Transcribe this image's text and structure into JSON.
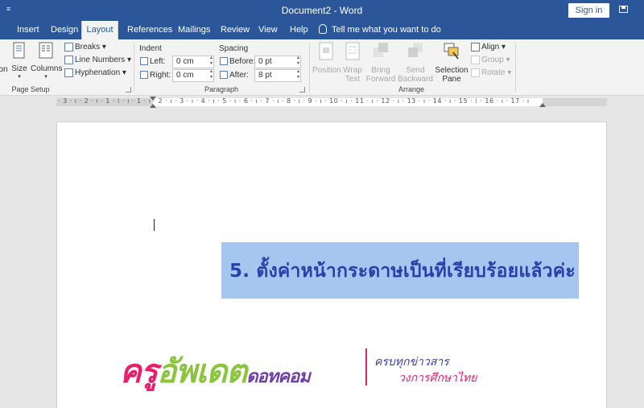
{
  "titlebar": {
    "quick_access": "≡",
    "title": "Document2 - Word",
    "signin": "Sign in"
  },
  "tabs": [
    {
      "label": "Insert"
    },
    {
      "label": "Design"
    },
    {
      "label": "Layout"
    },
    {
      "label": "References"
    },
    {
      "label": "Mailings"
    },
    {
      "label": "Review"
    },
    {
      "label": "View"
    },
    {
      "label": "Help"
    }
  ],
  "active_tab": "Layout",
  "tell_me": "Tell me what you want to do",
  "ribbon": {
    "page_setup": {
      "orientation_partial": "on",
      "size": "Size",
      "columns": "Columns",
      "breaks": "Breaks ▾",
      "line_numbers": "Line Numbers ▾",
      "hyphenation": "Hyphenation ▾",
      "label": "Page Setup"
    },
    "paragraph": {
      "indent_heading": "Indent",
      "spacing_heading": "Spacing",
      "left_label": "Left:",
      "left_value": "0 cm",
      "right_label": "Right:",
      "right_value": "0 cm",
      "before_label": "Before:",
      "before_value": "0 pt",
      "after_label": "After:",
      "after_value": "8 pt",
      "label": "Paragraph"
    },
    "arrange": {
      "position": "Position",
      "wrap_text": "Wrap Text",
      "bring_forward": "Bring Forward",
      "send_backward": "Send Backward",
      "selection_pane": "Selection Pane",
      "align": "Align ▾",
      "group": "Group ▾",
      "rotate": "Rotate ▾",
      "label": "Arrange",
      "wrap_l1": "Wrap",
      "wrap_l2": "Text",
      "bring_l1": "Bring",
      "bring_l2": "Forward",
      "send_l1": "Send",
      "send_l2": "Backward",
      "sel_l1": "Selection",
      "sel_l2": "Pane"
    }
  },
  "ruler": {
    "numbers": "· 3 · ı · 2 · ı · 1 · ⁞ · ı · 1 · ı · 2 · ı · 3 · ı · 4 · ı · 5 · ı · 6 · ı · 7 · ı · 8 · ı · 9 · ı · 10 · ı · 11 · ı · 12 · ı · 13 · ı · 14 · ı · 15 · ⁞ · 16 · ı · 17 · ı"
  },
  "document": {
    "highlight_text": "5. ตั้งค่าหน้ากระดาษเป็นที่เรียบร้อยแล้วค่ะ",
    "logo_part1": "ครู",
    "logo_part2": "อัพเดต",
    "logo_part3": "ดอทคอม",
    "logo_tag1": "ครบทุกข่าวสาร",
    "logo_tag2": "วงการศึกษาไทย"
  },
  "colors": {
    "title_blue": "#2b579a",
    "highlight": "#a4c6ef",
    "logo_pink": "#e6206a",
    "logo_green": "#8bc43f"
  }
}
